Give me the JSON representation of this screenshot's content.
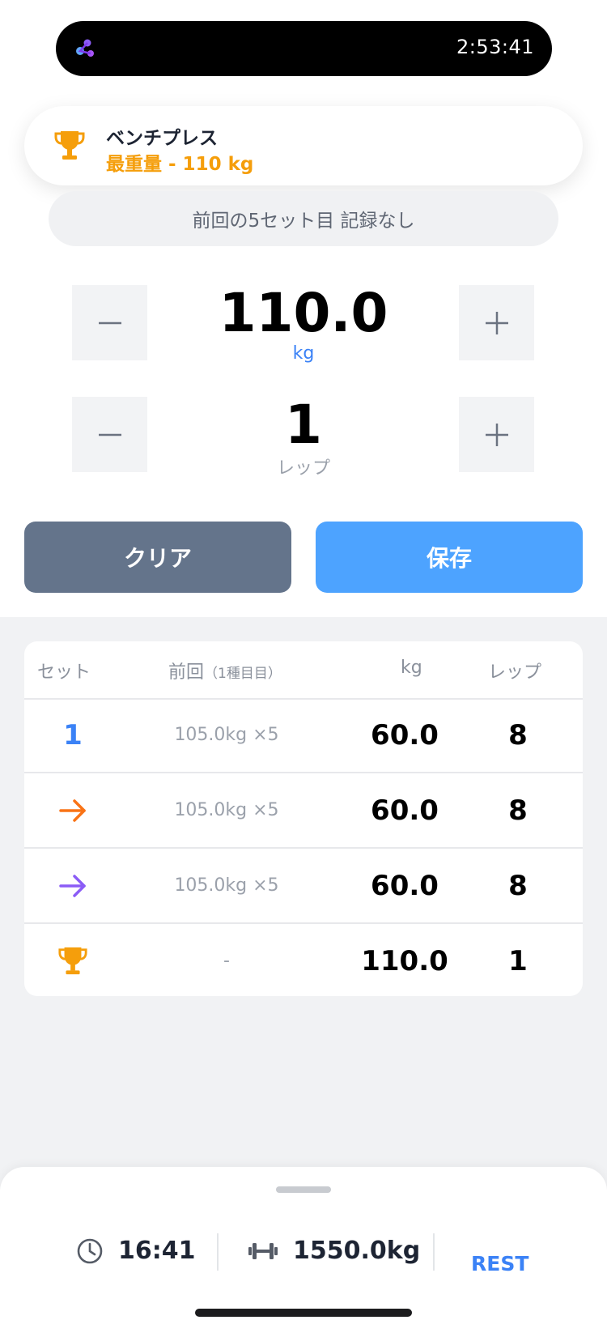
{
  "status": {
    "time": "2:53:41"
  },
  "exercise": {
    "name": "ベンチプレス",
    "best": "最重量 - 110 kg",
    "previous_note": "前回の5セット目 記録なし"
  },
  "weight": {
    "value": "110.0",
    "unit": "kg",
    "minus": "−",
    "plus": "+"
  },
  "reps": {
    "value": "1",
    "unit": "レップ"
  },
  "actions": {
    "clear": "クリア",
    "save": "保存"
  },
  "table": {
    "headers": {
      "set": "セット",
      "previous": "前回",
      "previous_sub": "（1種目目）",
      "kg": "kg",
      "reps": "レップ"
    },
    "rows": [
      {
        "set_label": "1",
        "set_kind": "number",
        "previous": "105.0kg ×5",
        "kg": "60.0",
        "reps": "8"
      },
      {
        "set_label": "",
        "set_kind": "arrow-orange",
        "previous": "105.0kg ×5",
        "kg": "60.0",
        "reps": "8"
      },
      {
        "set_label": "",
        "set_kind": "arrow-purple",
        "previous": "105.0kg ×5",
        "kg": "60.0",
        "reps": "8"
      },
      {
        "set_label": "",
        "set_kind": "trophy",
        "previous": "-",
        "kg": "110.0",
        "reps": "1"
      }
    ]
  },
  "summary": {
    "duration": "16:41",
    "volume": "1550.0kg",
    "rest": "REST"
  },
  "colors": {
    "accent_blue": "#4da3ff",
    "clear_gray": "#64748b",
    "trophy_orange": "#f59e0b",
    "arrow_orange": "#f97316",
    "arrow_purple": "#8b5cf6",
    "number_blue": "#3b82f6"
  }
}
